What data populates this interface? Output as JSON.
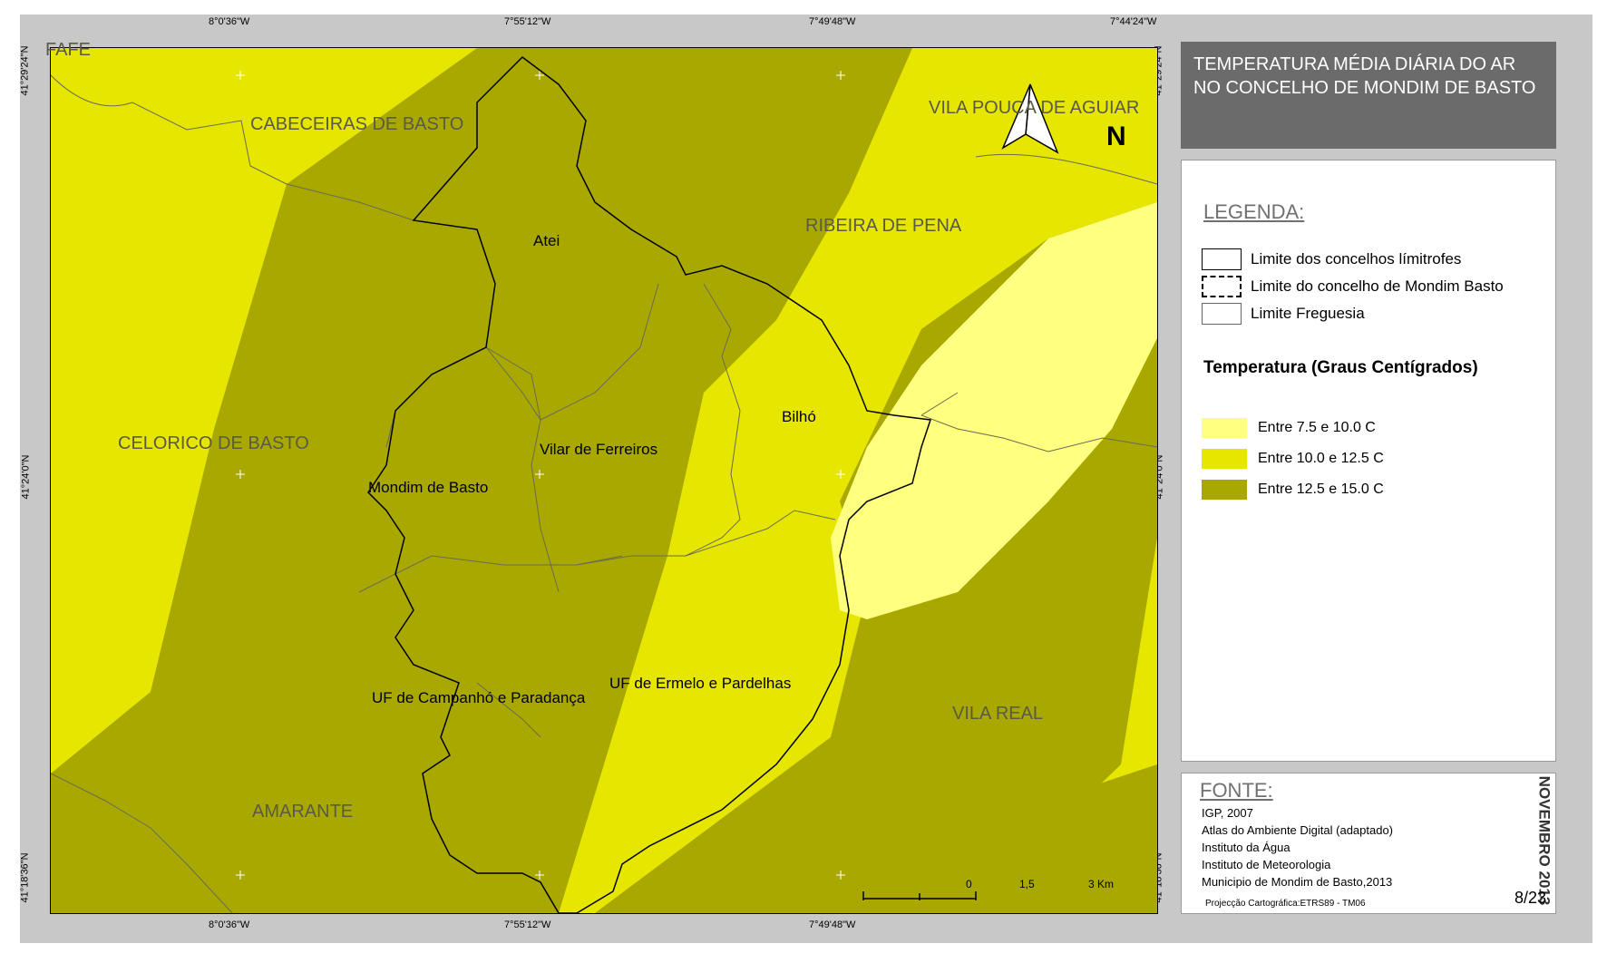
{
  "title": "TEMPERATURA MÉDIA DIÁRIA DO AR\nNO CONCELHO DE MONDIM DE BASTO",
  "coords": {
    "top": [
      "8°0'36\"W",
      "7°55'12\"W",
      "7°49'48\"W",
      "7°44'24\"W"
    ],
    "bottom": [
      "8°0'36\"W",
      "7°55'12\"W",
      "7°49'48\"W"
    ],
    "left": [
      "41°29'24\"N",
      "41°24'0\"N",
      "41°18'36\"N"
    ],
    "right": [
      "41°29'24\"N",
      "41°24'0\"N",
      "41°18'36\"N"
    ]
  },
  "map": {
    "neighbors": [
      "FAFE",
      "CABECEIRAS DE BASTO",
      "VILA POUCA DE AGUIAR",
      "RIBEIRA DE PENA",
      "CELORICO DE BASTO",
      "VILA REAL",
      "AMARANTE"
    ],
    "parishes": [
      "Atei",
      "Vilar de Ferreiros",
      "Bilhó",
      "Mondim de Basto",
      "UF de Campanhó e Paradança",
      "UF de Ermelo e Pardelhas"
    ],
    "north_label": "N",
    "scale": {
      "ticks": [
        "0",
        "1,5",
        "3 Km"
      ]
    }
  },
  "legend": {
    "heading": "LEGENDA:",
    "lines": [
      "Limite dos concelhos límitrofes",
      "Limite do concelho de Mondim Basto",
      "Limite Freguesia"
    ],
    "temp_heading": "Temperatura (Graus Centígrados)",
    "classes": [
      {
        "label": "Entre 7.5 e 10.0 C",
        "color": "#ffff80"
      },
      {
        "label": "Entre 10.0 e 12.5 C",
        "color": "#e6e600"
      },
      {
        "label": "Entre 12.5 e 15.0 C",
        "color": "#a9a800"
      }
    ]
  },
  "source": {
    "heading": "FONTE:",
    "items": [
      "IGP, 2007",
      "Atlas do Ambiente Digital (adaptado)",
      "Instituto da Água",
      "Instituto de Meteorologia",
      "Municipio de Mondim de Basto,2013"
    ],
    "projection": "Projecção Cartográfica:ETRS89 - TM06",
    "date": "NOVEMBRO 2013",
    "page": "8/23"
  }
}
